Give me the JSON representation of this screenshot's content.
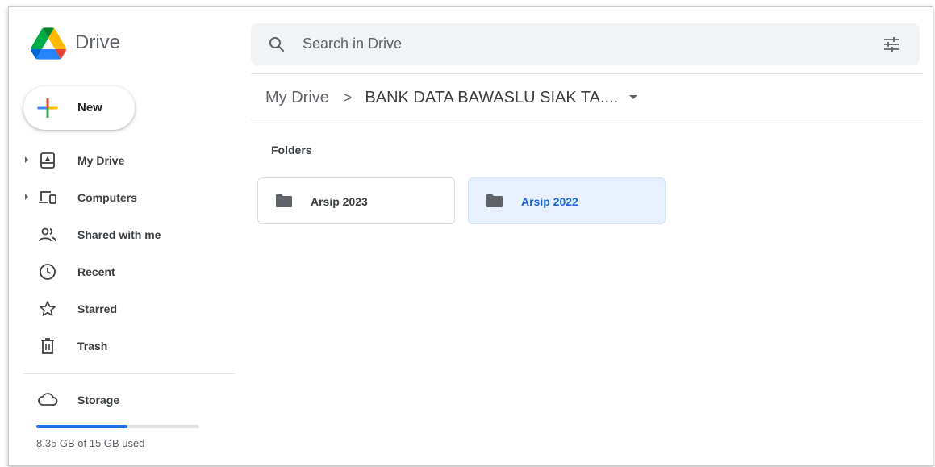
{
  "app": {
    "name": "Drive"
  },
  "search": {
    "placeholder": "Search in Drive"
  },
  "new_button": {
    "label": "New"
  },
  "sidebar": {
    "items": [
      {
        "label": "My Drive",
        "icon": "my-drive-icon",
        "expandable": true
      },
      {
        "label": "Computers",
        "icon": "computers-icon",
        "expandable": true
      },
      {
        "label": "Shared with me",
        "icon": "people-icon",
        "expandable": false
      },
      {
        "label": "Recent",
        "icon": "clock-icon",
        "expandable": false
      },
      {
        "label": "Starred",
        "icon": "star-icon",
        "expandable": false
      },
      {
        "label": "Trash",
        "icon": "trash-icon",
        "expandable": false
      }
    ],
    "storage": {
      "label": "Storage",
      "usage_text": "8.35 GB of 15 GB used",
      "used_fraction": 0.557
    }
  },
  "breadcrumb": {
    "root": "My Drive",
    "separator": ">",
    "current": "BANK DATA BAWASLU SIAK TA...."
  },
  "main": {
    "section_title": "Folders",
    "folders": [
      {
        "name": "Arsip 2023",
        "selected": false
      },
      {
        "name": "Arsip 2022",
        "selected": true
      }
    ]
  },
  "colors": {
    "accent": "#1a73e8",
    "selected_bg": "#e8f0fe",
    "selected_text": "#1967d2",
    "search_bg": "#f1f3f4"
  }
}
